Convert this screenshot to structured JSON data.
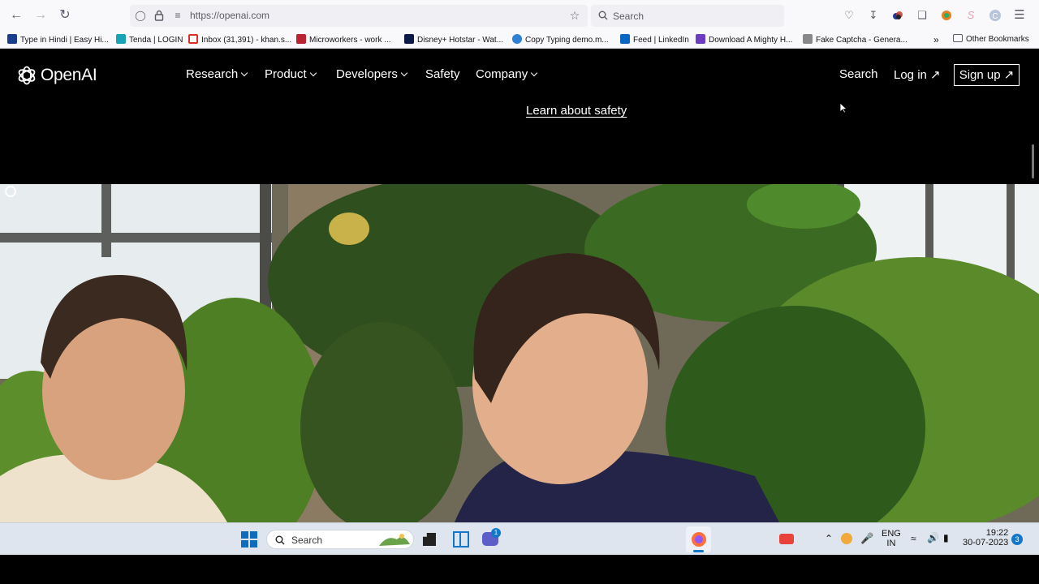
{
  "browser": {
    "url": "https://openai.com",
    "search_placeholder": "Search",
    "bookmarks": [
      {
        "label": "Type in Hindi | Easy Hi...",
        "color": "#1a3e8c"
      },
      {
        "label": "Tenda | LOGIN",
        "color": "#17a2b8"
      },
      {
        "label": "Inbox (31,391) - khan.s...",
        "color": "#d93025"
      },
      {
        "label": "Microworkers - work ...",
        "color": "#b8232f"
      },
      {
        "label": "Disney+ Hotstar - Wat...",
        "color": "#0c1a4a"
      },
      {
        "label": "Copy Typing demo.m...",
        "color": "#2f7fd6"
      },
      {
        "label": "Feed | LinkedIn",
        "color": "#0a66c2"
      },
      {
        "label": "Download A Mighty H...",
        "color": "#6c3cc4"
      },
      {
        "label": "Fake Captcha - Genera...",
        "color": "#888888"
      }
    ],
    "other_bookmarks": "Other Bookmarks"
  },
  "site": {
    "logo_text": "OpenAI",
    "nav": [
      "Research",
      "Product",
      "Developers",
      "Safety",
      "Company"
    ],
    "search": "Search",
    "login": "Log in ↗",
    "signup": "Sign up ↗",
    "learn_safety": "Learn about safety"
  },
  "taskbar": {
    "search_placeholder": "Search",
    "chat_badge": "1",
    "language_top": "ENG",
    "language_bottom": "IN",
    "time": "19:22",
    "date": "30-07-2023",
    "notification_count": "3"
  }
}
